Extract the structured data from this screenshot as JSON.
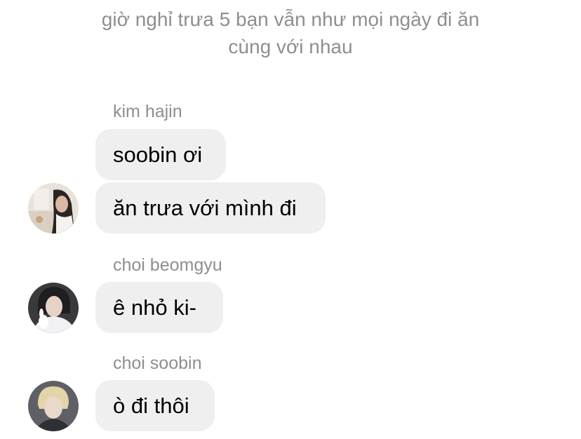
{
  "narration": {
    "line1": "giờ nghỉ trưa 5 bạn vẫn như mọi ngày đi ăn",
    "line2": "cùng với nhau"
  },
  "messages": [
    {
      "sender": "kim hajin",
      "avatar_icon": "profile-photo-hajin",
      "bubbles": [
        "soobin ơi",
        "ăn trưa với mình đi"
      ]
    },
    {
      "sender": "choi beomgyu",
      "avatar_icon": "profile-photo-beomgyu",
      "bubbles": [
        "ê nhỏ ki-"
      ]
    },
    {
      "sender": "choi soobin",
      "avatar_icon": "profile-photo-soobin",
      "bubbles": [
        "ò đi thôi"
      ]
    }
  ],
  "colors": {
    "bubble_background": "#efeff0",
    "secondary_text": "#8e8e93",
    "message_text": "#000000",
    "page_background": "#ffffff"
  }
}
